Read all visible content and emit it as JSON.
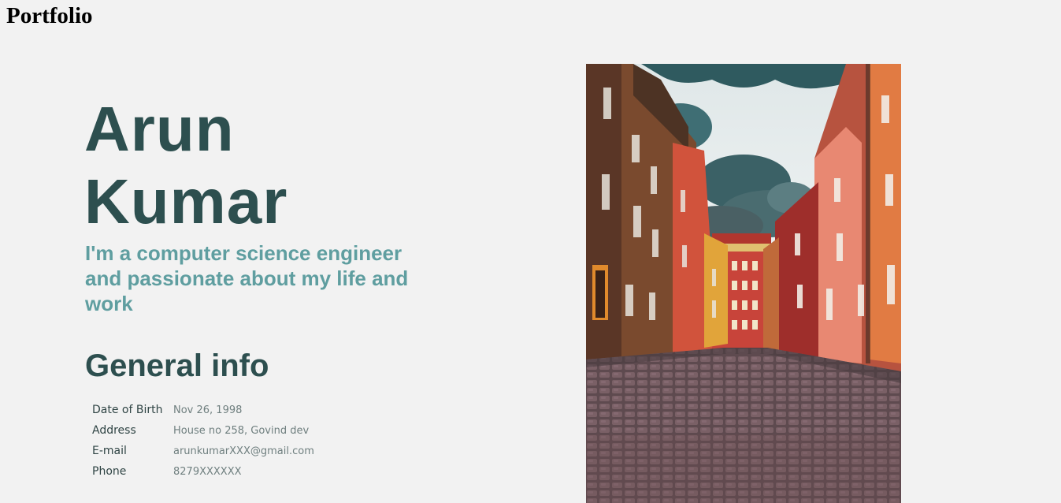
{
  "header": {
    "site_title": "Portfolio"
  },
  "hero": {
    "first_name": "Arun",
    "last_name": "Kumar",
    "tagline": "I'm a computer science engineer and passionate about my life and work"
  },
  "general_info": {
    "title": "General info",
    "rows": [
      {
        "label": "Date of Birth",
        "value": "Nov 26, 1998"
      },
      {
        "label": "Address",
        "value": "House no 258, Govind dev"
      },
      {
        "label": "E-mail",
        "value": "arunkumarXXX@gmail.com"
      },
      {
        "label": "Phone",
        "value": "8279XXXXXX"
      }
    ]
  },
  "photo": {
    "subject": "cobblestone-street-photo"
  },
  "colors": {
    "background": "#f2f2f2",
    "heading": "#2d4f4f",
    "accent": "#5f9ea0"
  }
}
